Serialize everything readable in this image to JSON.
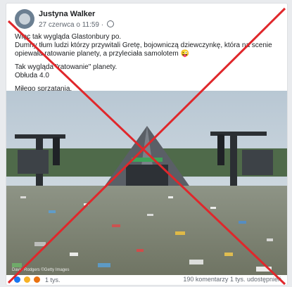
{
  "post": {
    "author": "Justyna Walker",
    "date": "27 czerwca o 11:59",
    "lines": [
      "Więc tak wygląda Glastonbury po.",
      "Dumny tłum ludzi którzy przywitali Gretę, bojowniczą dziewczynkę, która na scenie opiewała ratowanie planety, a przyleciała samolotem 😜",
      "Tak wygląda \"ratowanie\" planety.",
      "Obłuda 4.0",
      "Miłego sprzątania."
    ],
    "photo_credit": "David Rodgers ©Getty Images"
  },
  "footer": {
    "reaction_count": "1 tys.",
    "comments": "190 komentarzy",
    "shares": "1 tys. udostępnień"
  },
  "colors": {
    "cross": "#e0272b",
    "sky": "#c9d6e0",
    "ground": "#8c8f83"
  },
  "icons": [
    "avatar",
    "globe-icon",
    "like-reaction-icon",
    "haha-reaction-icon",
    "angry-reaction-icon"
  ]
}
